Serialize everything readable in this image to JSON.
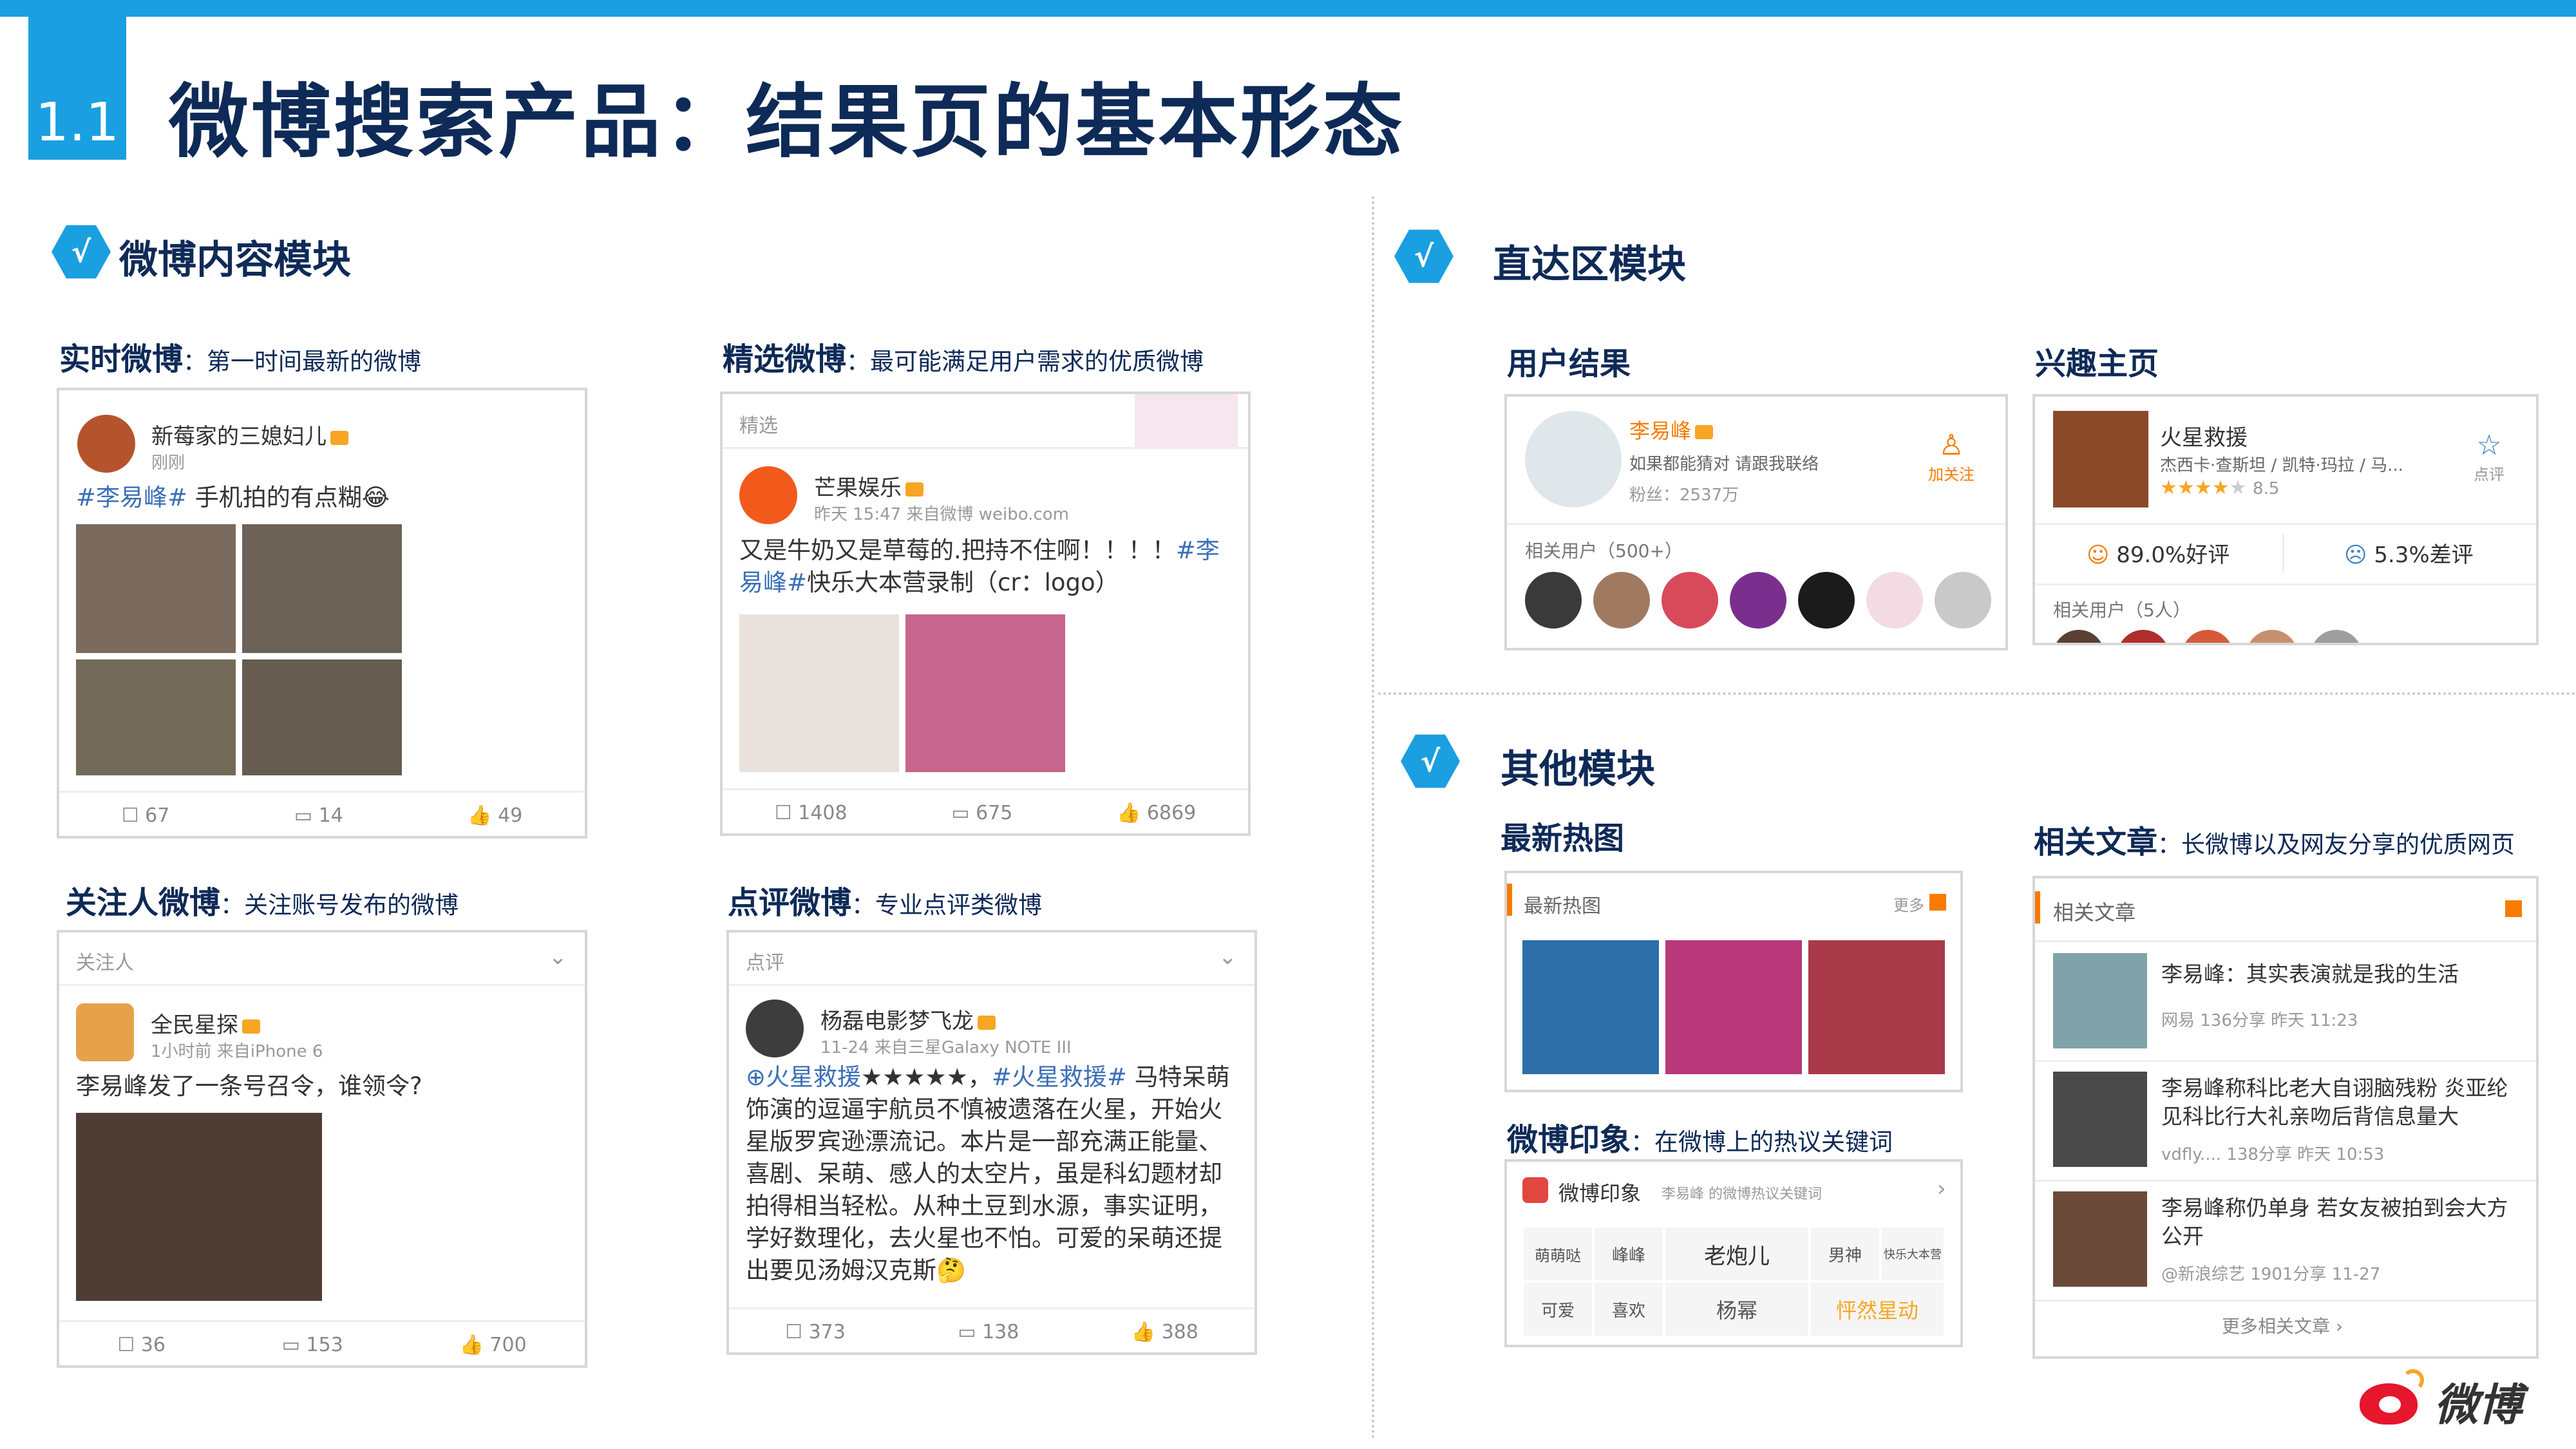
{
  "header": {
    "section_number": "1.1",
    "title": "微博搜索产品：结果页的基本形态"
  },
  "colors": {
    "accent": "#1a9fe0",
    "title": "#0e2a57",
    "link": "#3b6fb6",
    "orange": "#f87b00"
  },
  "left": {
    "module_title": "微博内容模块",
    "realtime": {
      "head": "实时微博",
      "desc": "：第一时间最新的微博",
      "user": "新莓家的三媳妇儿",
      "time": "刚刚",
      "text_tag": "#李易峰#",
      "text": " 手机拍的有点糊😂",
      "stats": [
        "67",
        "14",
        "49"
      ]
    },
    "featured": {
      "head": "精选微博",
      "desc": "：最可能满足用户需求的优质微博",
      "bar": "精选",
      "user": "芒果娱乐",
      "time": "昨天 15:47  来自微博 weibo.com",
      "text": "又是牛奶又是草莓的.把持不住啊！！！！",
      "text_tag": "#李易峰#",
      "text2": "快乐大本营录制（cr：logo）",
      "stats": [
        "1408",
        "675",
        "6869"
      ]
    },
    "following": {
      "head": "关注人微博",
      "desc": "：关注账号发布的微博",
      "bar": "关注人",
      "user": "全民星探",
      "time": "1小时前  来自iPhone 6",
      "text": "李易峰发了一条号召令，谁领令?",
      "stats": [
        "36",
        "153",
        "700"
      ]
    },
    "review": {
      "head": "点评微博",
      "desc": "：专业点评类微博",
      "bar": "点评",
      "user": "杨磊电影梦飞龙",
      "time": "11-24  来自三星Galaxy NOTE III",
      "text_link": "⊕火星救援",
      "text_stars": "★★★★★，",
      "text_tag": "#火星救援#",
      "text": " 马特呆萌饰演的逗逼宇航员不慎被遗落在火星，开始火星版罗宾逊漂流记。本片是一部充满正能量、喜剧、呆萌、感人的太空片，虽是科幻题材却拍得相当轻松。从种土豆到水源，事实证明，学好数理化，去火星也不怕。可爱的呆萌还提出要见汤姆汉克斯🤔",
      "stats": [
        "373",
        "138",
        "388"
      ]
    }
  },
  "right": {
    "direct_title": "直达区模块",
    "user_result": {
      "head": "用户结果",
      "name": "李易峰",
      "line1": "如果都能猜对 请跟我联络",
      "fans": "粉丝：2537万",
      "follow": "加关注",
      "related": "相关用户（500+）"
    },
    "interest": {
      "head": "兴趣主页",
      "title": "火星救援",
      "meta": "杰西卡·查斯坦 / 凯特·玛拉 / 马...",
      "stars": "★★★★",
      "star_empty": "★",
      "score": "8.5",
      "rate_label": "点评",
      "good": "89.0%好评",
      "bad": "5.3%差评",
      "related": "相关用户（5人）"
    },
    "other_title": "其他模块",
    "hot_pics": {
      "head": "最新热图",
      "bar": "最新热图",
      "more": "更多"
    },
    "impression": {
      "head": "微博印象",
      "desc": "：在微博上的热议关键词",
      "bar": "微博印象",
      "bar_sub": "李易峰 的微博热议关键词",
      "words": [
        "萌萌哒",
        "峰峰",
        "老炮儿",
        "男神",
        "快乐大本营",
        "可爱",
        "喜欢",
        "杨幂",
        "怦然星动"
      ]
    },
    "articles": {
      "head": "相关文章",
      "desc": "：长微博以及网友分享的优质网页",
      "bar": "相关文章",
      "items": [
        {
          "title": "李易峰：其实表演就是我的生活",
          "meta": "网易  136分享  昨天 11:23"
        },
        {
          "title": "李易峰称科比老大自诩脑残粉 炎亚纶见科比行大礼亲吻后背信息量大",
          "meta": "vdfly....  138分享  昨天 10:53"
        },
        {
          "title": "李易峰称仍单身 若女友被拍到会大方公开",
          "meta": "@新浪综艺  1901分享  11-27"
        }
      ],
      "more": "更多相关文章 ›"
    },
    "logo": "微博"
  }
}
